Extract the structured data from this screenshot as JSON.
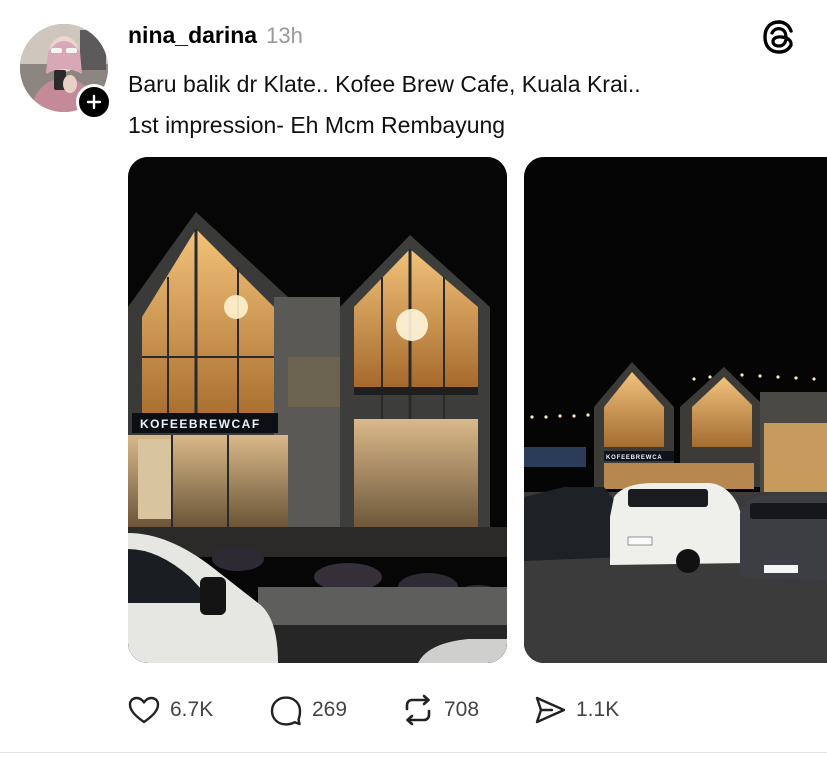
{
  "post": {
    "username": "nina_darina",
    "time": "13h",
    "caption_lines": [
      "Baru balik dr Klate.. Kofee Brew Cafe, Kuala Krai..",
      "1st impression- Eh Mcm Rembayung"
    ],
    "photos": [
      {
        "sign_text": "KOFEEBREWCAF"
      },
      {
        "sign_text": "KOFEEBREWCA"
      }
    ]
  },
  "actions": {
    "likes": "6.7K",
    "comments": "269",
    "reposts": "708",
    "shares": "1.1K"
  },
  "icons": {
    "follow": "plus-icon",
    "logo": "threads-logo-icon",
    "like": "heart-icon",
    "comment": "comment-bubble-icon",
    "repost": "repost-icon",
    "share": "send-icon"
  },
  "colors": {
    "text": "#000000",
    "muted": "#999999",
    "counts": "#444444"
  }
}
